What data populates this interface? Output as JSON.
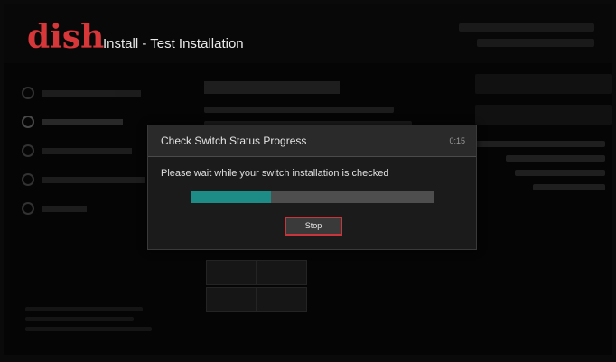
{
  "header": {
    "logo_text": "dish",
    "title": "Install - Test Installation"
  },
  "dialog": {
    "title": "Check Switch Status Progress",
    "timer": "0:15",
    "message": "Please wait while your switch installation is checked",
    "progress": 0.33,
    "stop_label": "Stop"
  },
  "colors": {
    "brand_red": "#d8373a",
    "progress_fill": "#1d8c86",
    "progress_track": "#4e4e4e",
    "focus_border": "#c8353a"
  },
  "icons": {
    "nav_step": "circle-step-icon"
  }
}
